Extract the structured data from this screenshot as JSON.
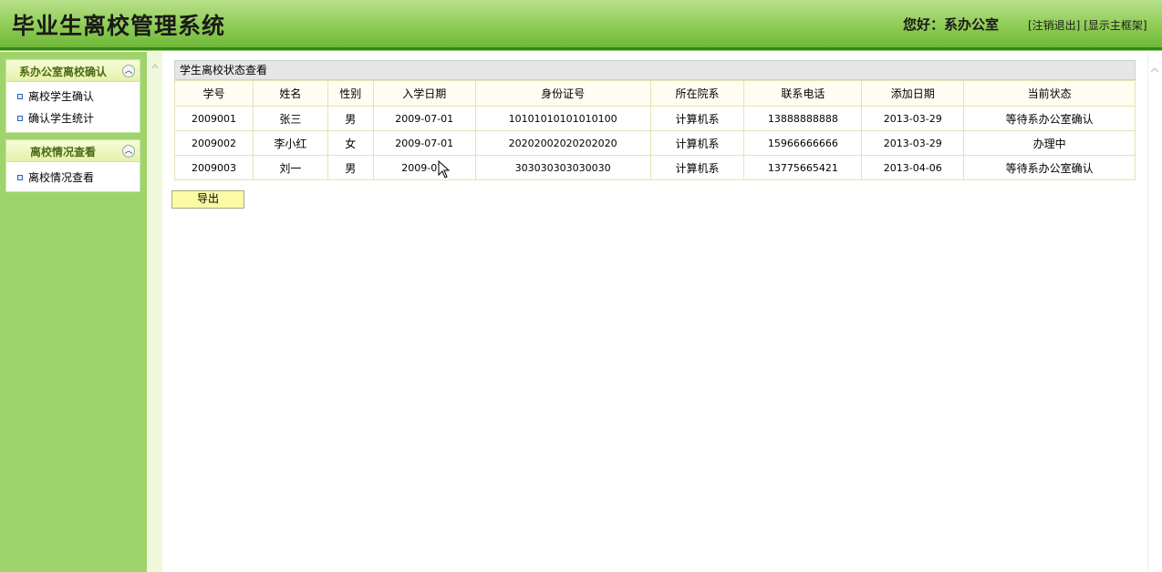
{
  "header": {
    "app_title": "毕业生离校管理系统",
    "greeting": "您好：系办公室",
    "logout_link": "[注销退出]",
    "main_frame_link": "[显示主框架]"
  },
  "sidebar": {
    "sections": [
      {
        "title": "系办公室离校确认",
        "items": [
          "离校学生确认",
          "确认学生统计"
        ]
      },
      {
        "title": "离校情况查看",
        "items": [
          "离校情况查看"
        ]
      }
    ]
  },
  "main": {
    "panel_title": "学生离校状态查看",
    "columns": [
      "学号",
      "姓名",
      "性别",
      "入学日期",
      "身份证号",
      "所在院系",
      "联系电话",
      "添加日期",
      "当前状态"
    ],
    "rows": [
      [
        "2009001",
        "张三",
        "男",
        "2009-07-01",
        "10101010101010100",
        "计算机系",
        "13888888888",
        "2013-03-29",
        "等待系办公室确认"
      ],
      [
        "2009002",
        "李小红",
        "女",
        "2009-07-01",
        "20202002020202020",
        "计算机系",
        "15966666666",
        "2013-03-29",
        "办理中"
      ],
      [
        "2009003",
        "刘一",
        "男",
        "2009-07-",
        "303030303030030",
        "计算机系",
        "13775665421",
        "2013-04-06",
        "等待系办公室确认"
      ]
    ],
    "export_label": "导出"
  },
  "colors": {
    "header_green": "#8fcc55",
    "sidebar_green": "#9fd46c",
    "button_yellow": "#fbfba6"
  }
}
